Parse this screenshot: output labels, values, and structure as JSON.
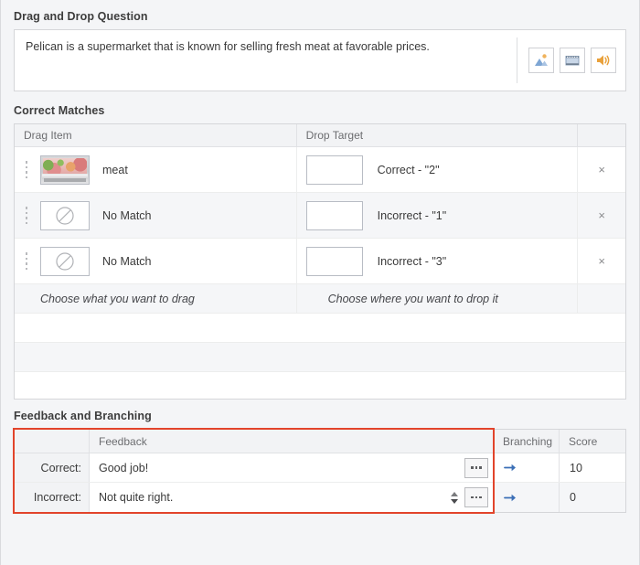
{
  "sections": {
    "drag_and_drop": "Drag and Drop Question",
    "correct_matches": "Correct Matches",
    "feedback_and_branching": "Feedback and Branching"
  },
  "question": {
    "text": "Pelican is a supermarket that is known for selling fresh meat at favorable prices.",
    "media_buttons": [
      {
        "name": "insert-image-button",
        "icon": "image-icon"
      },
      {
        "name": "insert-video-button",
        "icon": "video-icon"
      },
      {
        "name": "insert-audio-button",
        "icon": "audio-icon"
      }
    ]
  },
  "matches_table": {
    "columns": {
      "drag_item": "Drag Item",
      "drop_target": "Drop Target",
      "actions": ""
    },
    "rows": [
      {
        "drag_label": "meat",
        "drag_icon": "meat-photo",
        "drop_label": "Correct - \"2\"",
        "remove": "×"
      },
      {
        "drag_label": "No Match",
        "drag_icon": "no-match-icon",
        "drop_label": "Incorrect - \"1\"",
        "remove": "×"
      },
      {
        "drag_label": "No Match",
        "drag_icon": "no-match-icon",
        "drop_label": "Incorrect - \"3\"",
        "remove": "×"
      }
    ],
    "hints": {
      "drag": "Choose what you want to drag",
      "drop": "Choose where you want to drop it"
    },
    "empty_row_count": 4
  },
  "feedback_table": {
    "columns": {
      "row_label": "",
      "feedback": "Feedback",
      "branching": "Branching",
      "score": "Score"
    },
    "rows": [
      {
        "label": "Correct:",
        "feedback": "Good job!",
        "has_spinner": false,
        "branching_icon": "branch-arrow-icon",
        "score": "10"
      },
      {
        "label": "Incorrect:",
        "feedback": "Not quite right.",
        "has_spinner": true,
        "branching_icon": "branch-arrow-icon",
        "score": "0"
      }
    ],
    "highlight_color": "#e2442b"
  }
}
